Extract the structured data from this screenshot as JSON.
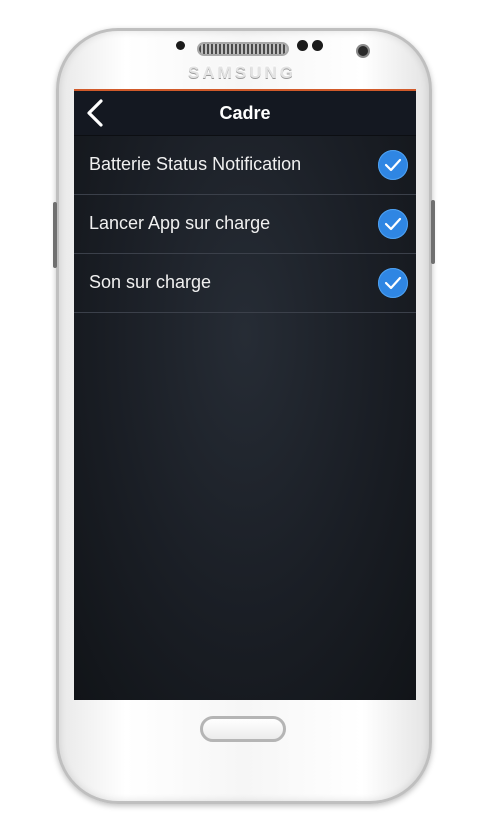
{
  "device": {
    "brand": "SAMSUNG"
  },
  "action_bar": {
    "title": "Cadre",
    "back_icon": "chevron-left-icon"
  },
  "settings": {
    "items": [
      {
        "label": "Batterie Status Notification",
        "checked": true
      },
      {
        "label": "Lancer App sur charge",
        "checked": true
      },
      {
        "label": "Son sur charge",
        "checked": true
      }
    ]
  },
  "colors": {
    "check_blue": "#2f86e3",
    "accent_orange": "#d15a2a",
    "action_bar_bg": "#141821"
  }
}
